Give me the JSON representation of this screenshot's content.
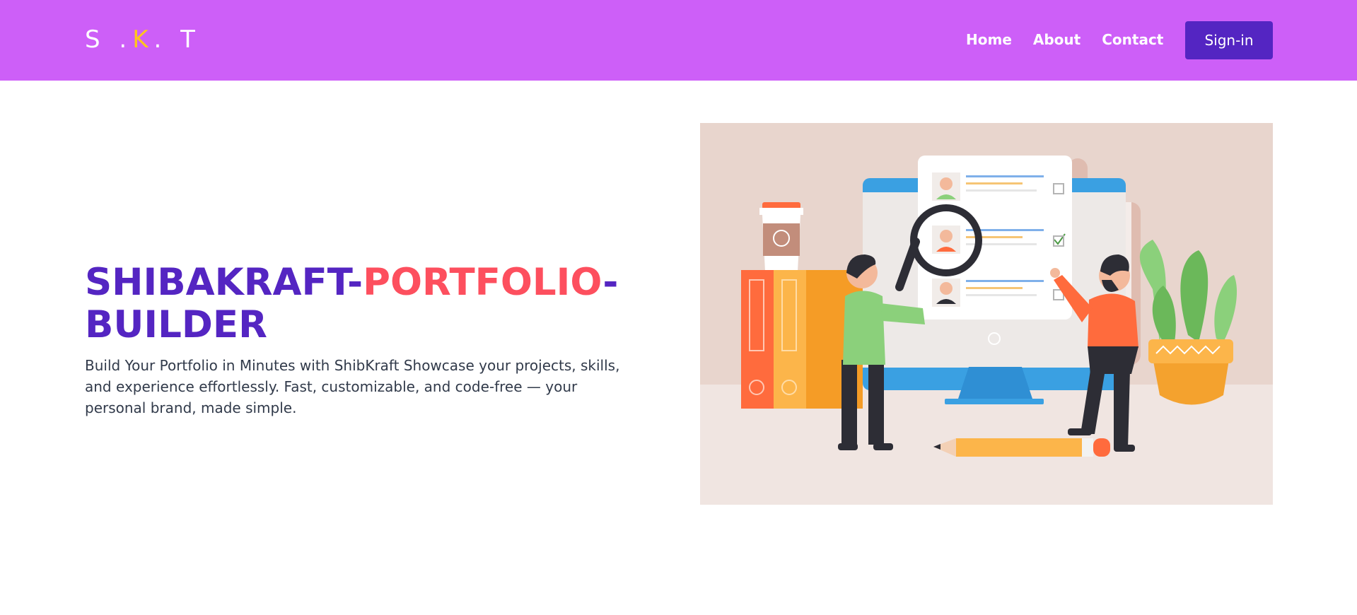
{
  "navbar": {
    "brand": {
      "first": "S .",
      "accent": "K",
      "last": ". T"
    },
    "links": [
      {
        "label": "Home"
      },
      {
        "label": "About"
      },
      {
        "label": "Contact"
      }
    ],
    "signin_label": "Sign-in"
  },
  "hero": {
    "title_part1": "SHIBAKRAFT-",
    "title_part2": "PORTFOLIO",
    "title_part3": "-BUILDER",
    "description": "Build Your Portfolio in Minutes with ShibKraft Showcase your projects, skills, and experience effortlessly. Fast, customizable, and code-free — your personal brand, made simple."
  },
  "colors": {
    "navbar_bg": "#cd5ff8",
    "brand_accent": "#ffc51d",
    "primary": "#5425c2",
    "title_highlight": "#fd4f5e",
    "text": "#313a4a"
  }
}
